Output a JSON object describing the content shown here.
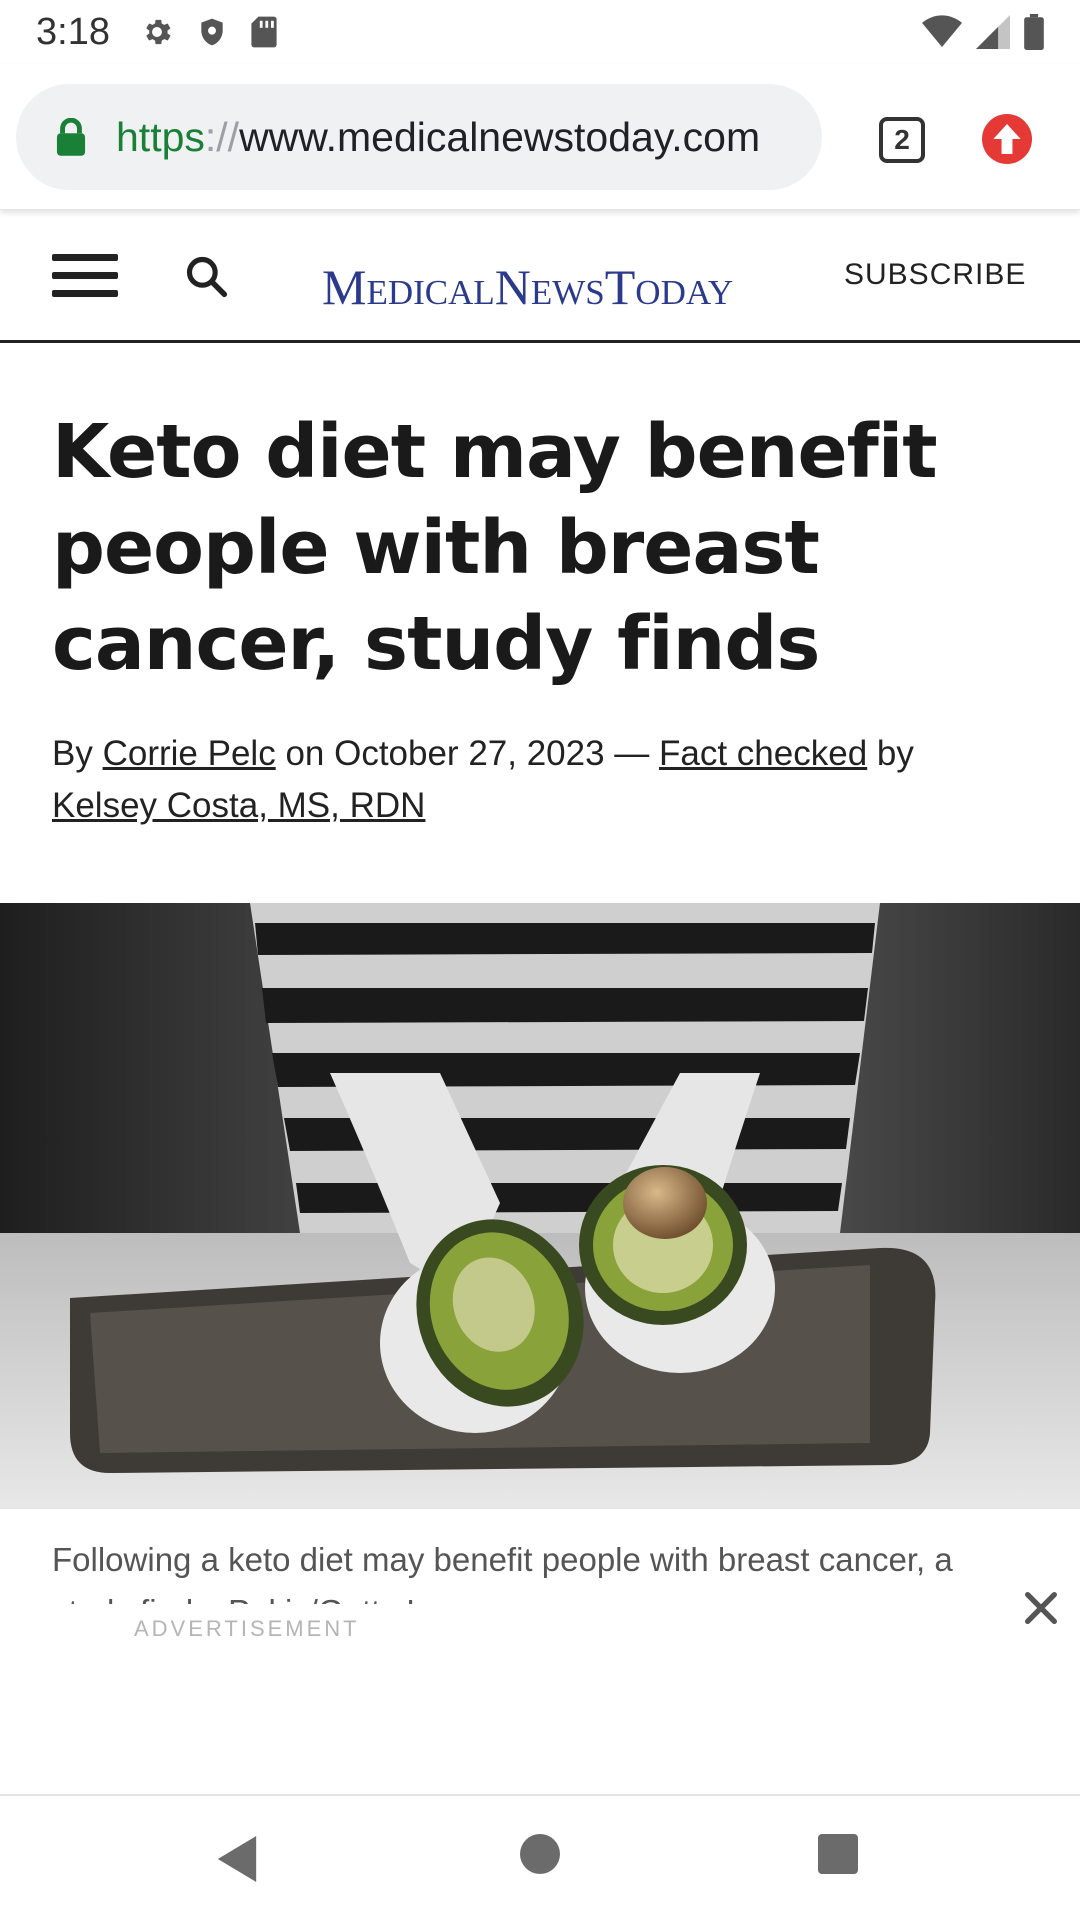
{
  "status_bar": {
    "time": "3:18",
    "left_icons": [
      "settings-gear-icon",
      "shield-icon",
      "sd-card-icon"
    ],
    "right_icons": [
      "wifi-icon",
      "cell-signal-icon",
      "battery-icon"
    ]
  },
  "browser": {
    "url_scheme": "https",
    "url_separator": "://",
    "url_host": "www.medicalnewstoday.com",
    "tab_count": "2",
    "lock_color": "#1a7f37",
    "update_color": "#e53935"
  },
  "site_header": {
    "logo": "MedicalNewsToday",
    "subscribe_label": "SUBSCRIBE",
    "logo_color": "#2b3a8c"
  },
  "article": {
    "headline": "Keto diet may benefit people with breast cancer, study finds",
    "byline": {
      "prefix": "By",
      "author": "Corrie Pelc",
      "date_text": "on October 27, 2023 —",
      "fact_checked_label": "Fact checked",
      "by_label": "by",
      "checker": "Kelsey Costa, MS, RDN"
    },
    "hero_image_alt": "hands-holding-avocado-halves",
    "caption": "Following a keto diet may benefit people with breast cancer, a study finds. Pekic/Getty Images"
  },
  "ad": {
    "label": "ADVERTISEMENT"
  },
  "nav_bar": {
    "icons": [
      "back-icon",
      "home-icon",
      "recents-icon"
    ]
  }
}
